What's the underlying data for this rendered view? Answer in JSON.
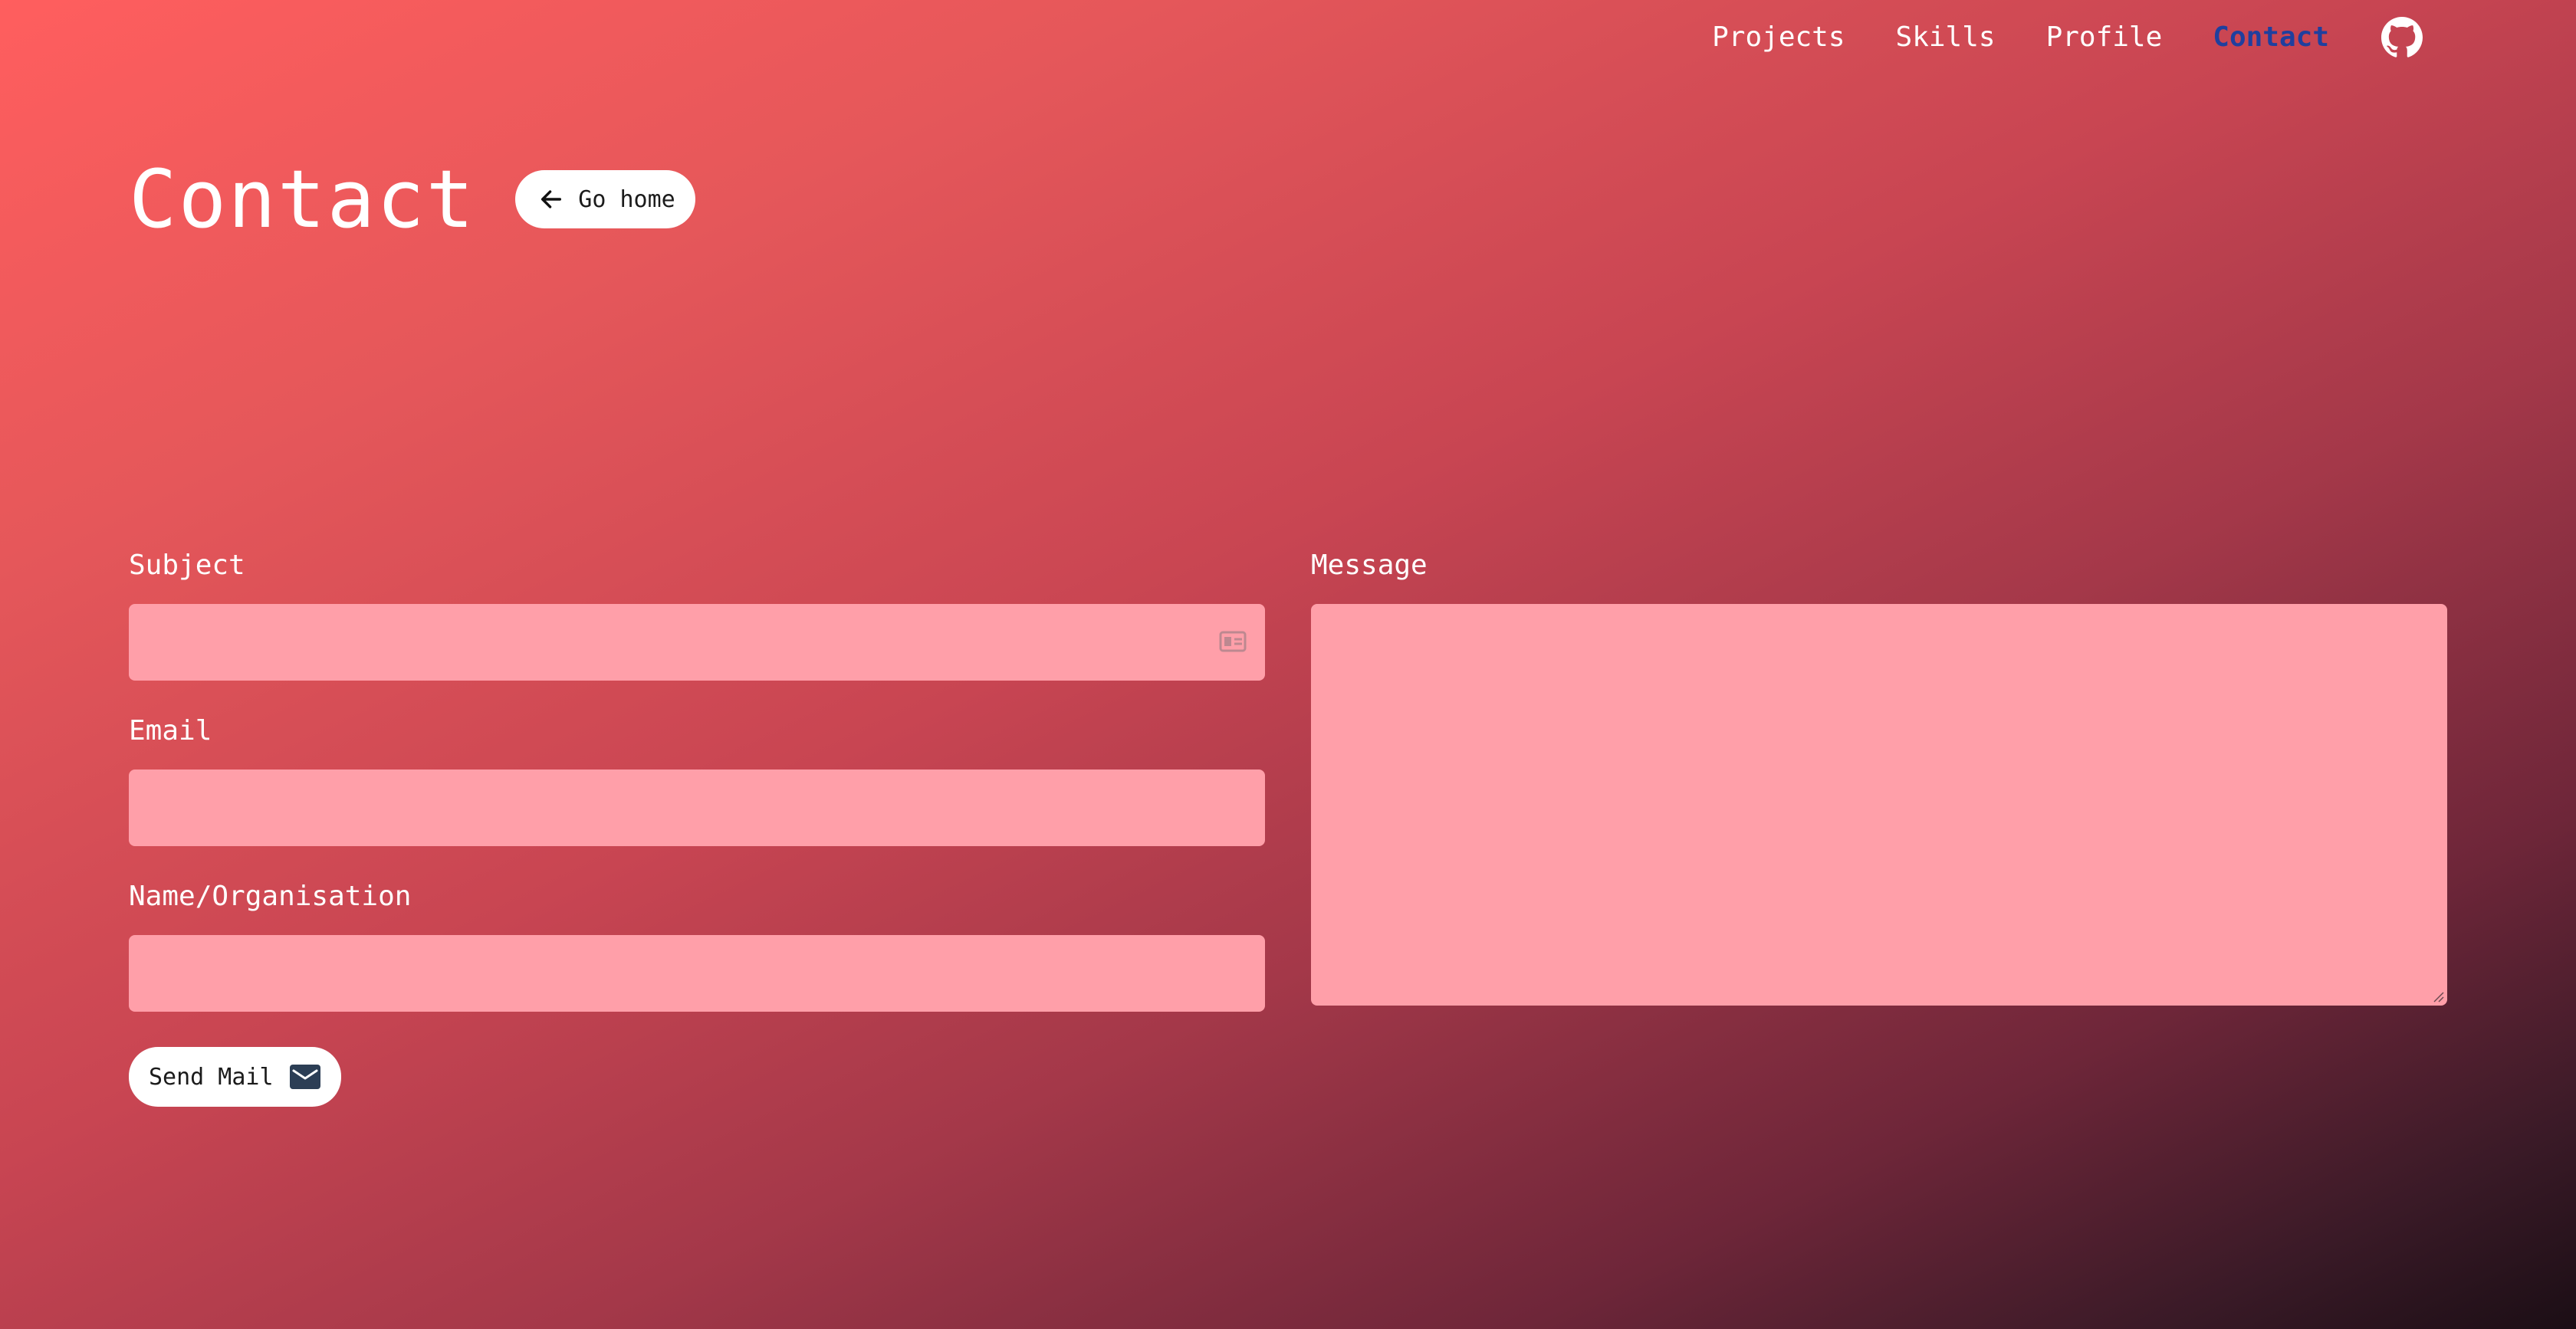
{
  "nav": {
    "items": [
      {
        "label": "Projects"
      },
      {
        "label": "Skills"
      },
      {
        "label": "Profile"
      },
      {
        "label": "Contact",
        "active": true
      }
    ],
    "github_icon": "github-icon",
    "active_color": "#1f3f9e"
  },
  "header": {
    "title": "Contact",
    "go_home_label": "Go home",
    "go_home_icon": "arrow-left-icon"
  },
  "form": {
    "subject": {
      "label": "Subject",
      "value": "",
      "icon": "contact-card-icon"
    },
    "email": {
      "label": "Email",
      "value": ""
    },
    "name": {
      "label": "Name/Organisation",
      "value": ""
    },
    "message": {
      "label": "Message",
      "value": ""
    },
    "send_label": "Send Mail",
    "send_icon": "mail-icon",
    "field_color": "#ff9fa9"
  }
}
